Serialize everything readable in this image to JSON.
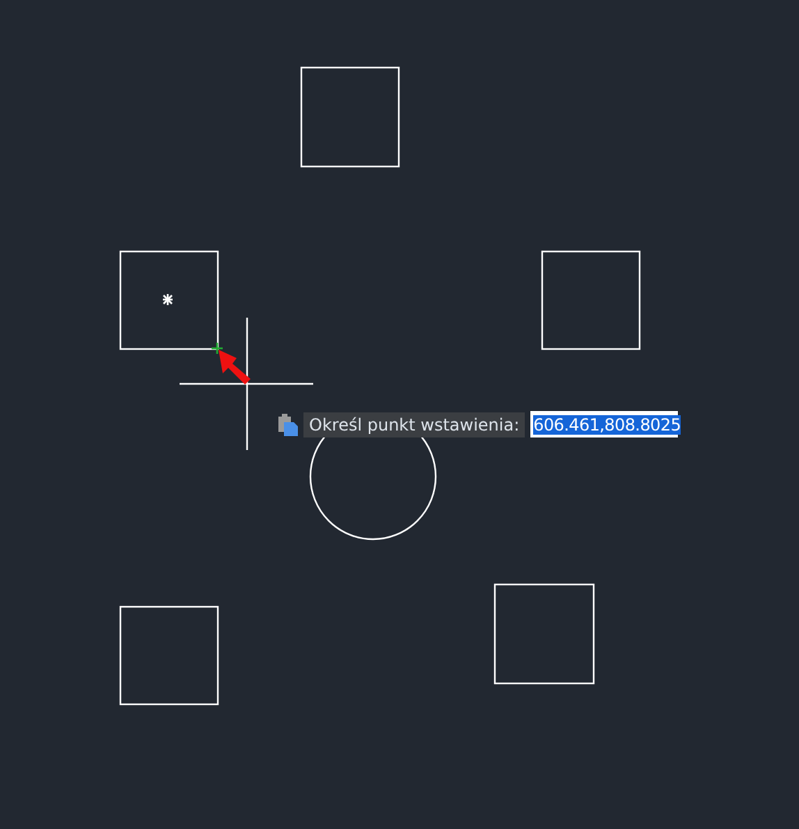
{
  "prompt": {
    "label": "Określ punkt wstawienia:",
    "value": "606.461,808.8025",
    "value_selected": true
  }
}
